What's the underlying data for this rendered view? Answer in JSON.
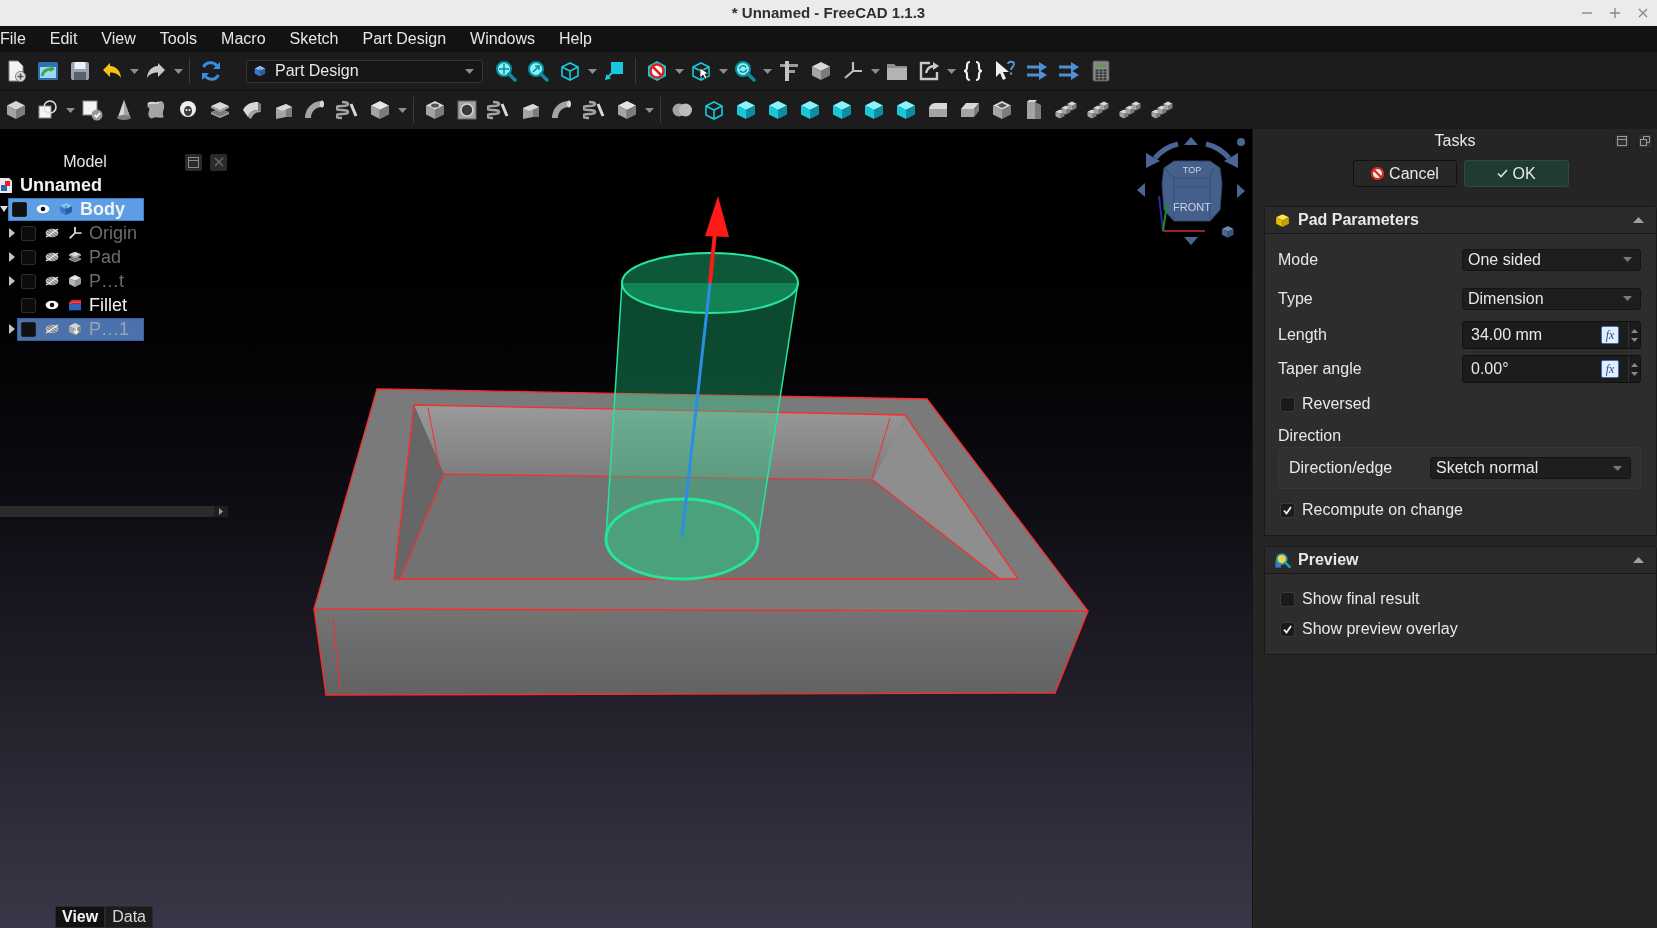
{
  "window": {
    "title": "* Unnamed - FreeCAD 1.1.3"
  },
  "menu": [
    "File",
    "Edit",
    "View",
    "Tools",
    "Macro",
    "Sketch",
    "Part Design",
    "Windows",
    "Help"
  ],
  "toolbar": {
    "workbench": "Part Design"
  },
  "tree": {
    "title": "Model",
    "root": {
      "label": "Unnamed",
      "children": [
        {
          "label": "Body",
          "kind": "body",
          "active": true,
          "selected": true,
          "checked": false,
          "visible": true,
          "expandable": true,
          "expanded": true,
          "children": [
            {
              "label": "Origin",
              "kind": "origin",
              "active": false,
              "selected": false,
              "checked": false,
              "visible": false,
              "expandable": true,
              "expanded": false
            },
            {
              "label": "Pad",
              "kind": "pad",
              "active": false,
              "selected": false,
              "checked": false,
              "visible": false,
              "expandable": true,
              "expanded": false
            },
            {
              "label": "P…t",
              "kind": "solid",
              "active": false,
              "selected": false,
              "checked": false,
              "visible": false,
              "expandable": true,
              "expanded": false
            },
            {
              "label": "Fillet",
              "kind": "fillet",
              "active": false,
              "selected": false,
              "checked": false,
              "visible": true,
              "expandable": false,
              "expanded": false
            },
            {
              "label": "P…1",
              "kind": "feature",
              "active": false,
              "selected": true,
              "checked": false,
              "visible": false,
              "expandable": true,
              "expanded": false
            }
          ]
        }
      ]
    }
  },
  "viewport": {
    "nav_cube": {
      "top": "TOP",
      "front": "FRONT"
    }
  },
  "property_tabs": [
    {
      "label": "View",
      "selected": true
    },
    {
      "label": "Data",
      "selected": false
    }
  ],
  "tasks": {
    "title": "Tasks",
    "buttons": [
      {
        "label": "Cancel",
        "kind": "cancel"
      },
      {
        "label": "OK",
        "kind": "ok"
      }
    ],
    "sections": [
      {
        "title": "Pad Parameters",
        "kind": "pad",
        "expanded": true,
        "rows": [
          {
            "kind": "combo",
            "label": "Mode",
            "value": "One sided"
          },
          {
            "kind": "combo",
            "label": "Type",
            "value": "Dimension"
          },
          {
            "kind": "spin",
            "label": "Length",
            "value": "34.00 mm",
            "button": "fx"
          },
          {
            "kind": "spin",
            "label": "Taper angle",
            "value": "0.00°",
            "button": "fx"
          },
          {
            "kind": "check",
            "label": "Reversed",
            "checked": false
          },
          {
            "kind": "group",
            "title": "Direction",
            "rows": [
              {
                "kind": "combo",
                "label": "Direction/edge",
                "value": "Sketch normal"
              }
            ]
          },
          {
            "kind": "check",
            "label": "Recompute on change",
            "checked": true
          }
        ]
      },
      {
        "title": "Preview",
        "kind": "preview",
        "expanded": true,
        "rows": [
          {
            "kind": "check",
            "label": "Show final result",
            "checked": false
          },
          {
            "kind": "check",
            "label": "Show preview overlay",
            "checked": true
          }
        ]
      }
    ]
  }
}
